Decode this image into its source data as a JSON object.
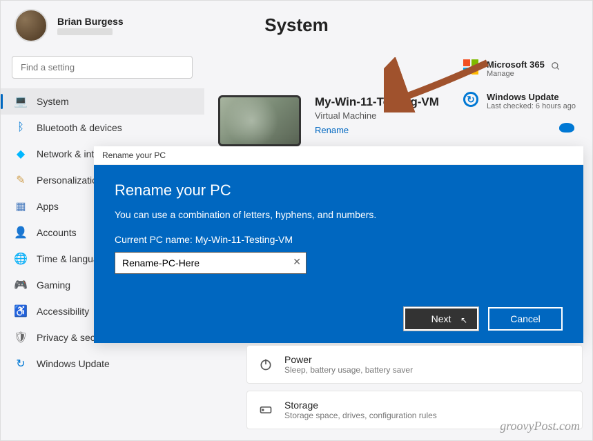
{
  "user": {
    "name": "Brian Burgess"
  },
  "page_title": "System",
  "search": {
    "placeholder": "Find a setting"
  },
  "sidebar": {
    "items": [
      {
        "label": "System",
        "icon": "💻",
        "color": "#0067c0",
        "active": true
      },
      {
        "label": "Bluetooth & devices",
        "icon": "ᛒ",
        "color": "#0078d4"
      },
      {
        "label": "Network & internet",
        "icon": "◆",
        "color": "#00b7ff"
      },
      {
        "label": "Personalization",
        "icon": "✎",
        "color": "#d0a050"
      },
      {
        "label": "Apps",
        "icon": "▦",
        "color": "#5080c0"
      },
      {
        "label": "Accounts",
        "icon": "👤",
        "color": "#30a060"
      },
      {
        "label": "Time & language",
        "icon": "🌐",
        "color": "#4a90d0"
      },
      {
        "label": "Gaming",
        "icon": "🎮",
        "color": "#888"
      },
      {
        "label": "Accessibility",
        "icon": "♿",
        "color": "#5090d0"
      },
      {
        "label": "Privacy & security",
        "icon": "🛡",
        "color": "#666"
      },
      {
        "label": "Windows Update",
        "icon": "↻",
        "color": "#0078d4"
      }
    ]
  },
  "device": {
    "name": "My-Win-11-Testing-VM",
    "type": "Virtual Machine",
    "rename_label": "Rename"
  },
  "right_cards": {
    "ms365": {
      "title": "Microsoft 365",
      "sub": "Manage"
    },
    "wu": {
      "title": "Windows Update",
      "sub": "Last checked: 6 hours ago"
    }
  },
  "dialog": {
    "titlebar": "Rename your PC",
    "heading": "Rename your PC",
    "subtitle": "You can use a combination of letters, hyphens, and numbers.",
    "current_label": "Current PC name: My-Win-11-Testing-VM",
    "input_value": "Rename-PC-Here",
    "next_label": "Next",
    "cancel_label": "Cancel"
  },
  "settings_rows": {
    "power": {
      "title": "Power",
      "sub": "Sleep, battery usage, battery saver"
    },
    "storage": {
      "title": "Storage",
      "sub": "Storage space, drives, configuration rules"
    }
  },
  "watermark": "groovyPost.com"
}
